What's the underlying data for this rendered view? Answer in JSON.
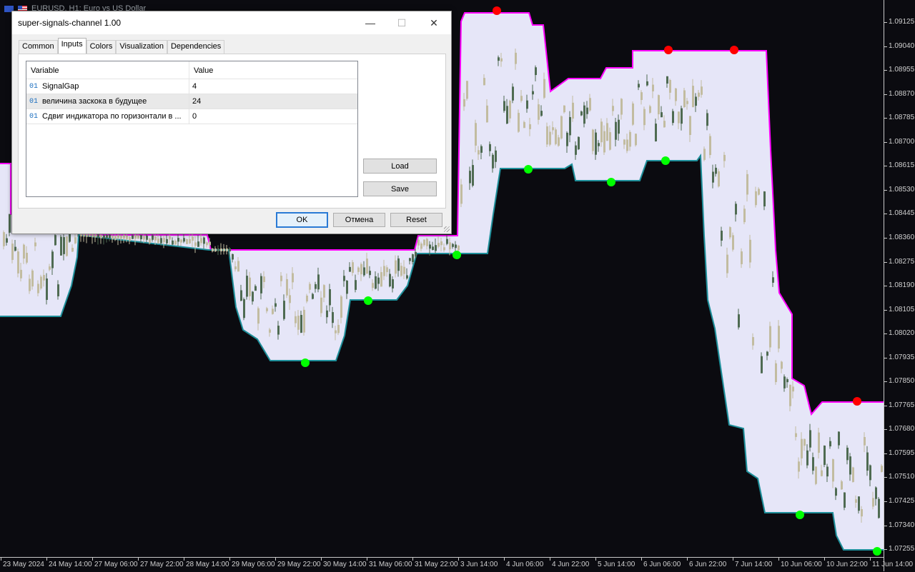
{
  "chart": {
    "title": "EURUSD, H1:  Euro vs US Dollar",
    "y_ticks": [
      "1.09125",
      "1.09040",
      "1.08955",
      "1.08870",
      "1.08785",
      "1.08700",
      "1.08615",
      "1.08530",
      "1.08445",
      "1.08360",
      "1.08275",
      "1.08190",
      "1.08105",
      "1.08020",
      "1.07935",
      "1.07850",
      "1.07765",
      "1.07680",
      "1.07595",
      "1.07510",
      "1.07425",
      "1.07340",
      "1.07255"
    ],
    "x_ticks": [
      "23 May 2024",
      "24 May 14:00",
      "27 May 06:00",
      "27 May 22:00",
      "28 May 14:00",
      "29 May 06:00",
      "29 May 22:00",
      "30 May 14:00",
      "31 May 06:00",
      "31 May 22:00",
      "3 Jun 14:00",
      "4 Jun 06:00",
      "4 Jun 22:00",
      "5 Jun 14:00",
      "6 Jun 06:00",
      "6 Jun 22:00",
      "7 Jun 14:00",
      "10 Jun 06:00",
      "10 Jun 22:00",
      "11 Jun 14:00"
    ],
    "colors": {
      "background": "#0b0b10",
      "channel_fill": "#e6e6f8",
      "upper_line": "#ff00ff",
      "lower_line": "#1e8f9a",
      "sell_signal": "#ff0000",
      "buy_signal": "#00ff00",
      "bull_candle": "#4f6b52",
      "bear_candle": "#c2bca0"
    }
  },
  "dialog": {
    "title": "super-signals-channel 1.00",
    "tabs": [
      "Common",
      "Inputs",
      "Colors",
      "Visualization",
      "Dependencies"
    ],
    "active_tab": "Inputs",
    "table": {
      "headers": [
        "Variable",
        "Value"
      ],
      "rows": [
        {
          "type_icon": "01",
          "name": "SignalGap",
          "value": "4"
        },
        {
          "type_icon": "01",
          "name": "величина заскока в будущее",
          "value": "24"
        },
        {
          "type_icon": "01",
          "name": "Сдвиг индикатора по горизонтали в ...",
          "value": "0"
        }
      ]
    },
    "side_buttons": {
      "load": "Load",
      "save": "Save"
    },
    "footer_buttons": {
      "ok": "OK",
      "cancel": "Отмена",
      "reset": "Reset"
    },
    "window_controls": {
      "minimize": "—",
      "maximize": "☐",
      "close": "✕"
    }
  }
}
